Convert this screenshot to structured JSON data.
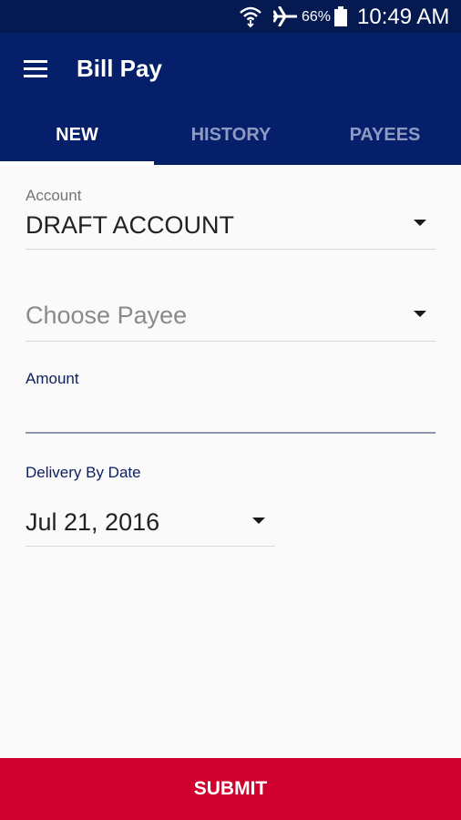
{
  "status_bar": {
    "battery_percent": "66%",
    "time": "10:49 AM",
    "icons": [
      "wifi-icon",
      "airplane-icon",
      "battery-icon"
    ]
  },
  "app_bar": {
    "title": "Bill Pay",
    "menu_icon": "hamburger-menu-icon"
  },
  "tabs": [
    {
      "label": "NEW",
      "active": true
    },
    {
      "label": "HISTORY",
      "active": false
    },
    {
      "label": "PAYEES",
      "active": false
    }
  ],
  "form": {
    "account": {
      "label": "Account",
      "value": "DRAFT ACCOUNT"
    },
    "payee": {
      "placeholder": "Choose Payee"
    },
    "amount": {
      "label": "Amount",
      "value": ""
    },
    "delivery_date": {
      "label": "Delivery By Date",
      "value": "Jul 21, 2016"
    }
  },
  "submit_label": "SUBMIT",
  "colors": {
    "primary": "#061f6b",
    "status_bar": "#061a52",
    "submit": "#d0002f",
    "label_accent": "#0d1f5c",
    "tab_inactive": "#8e9ac2"
  }
}
